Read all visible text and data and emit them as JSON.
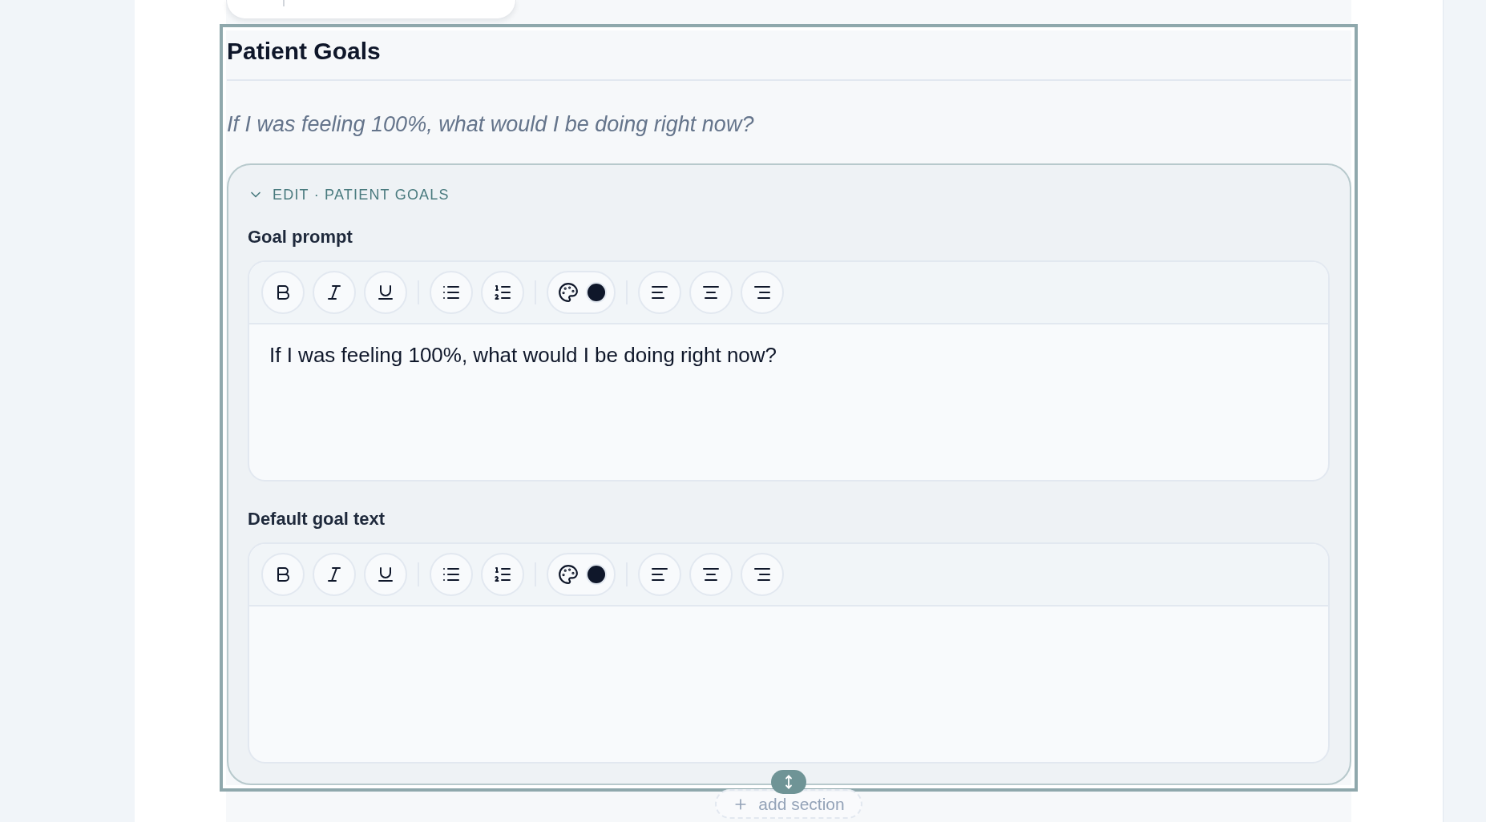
{
  "section": {
    "title": "Patient Goals",
    "prompt": "If I was feeling 100%, what would I be doing right now?",
    "selected": true,
    "editor_panel": {
      "heading": "EDIT · PATIENT GOALS",
      "expanded": true,
      "fields": [
        {
          "label": "Goal prompt",
          "value": "If I was feeling 100%, what would I be doing right now?"
        },
        {
          "label": "Default goal text"
        }
      ]
    }
  },
  "add_section": {
    "label": "add section"
  }
}
